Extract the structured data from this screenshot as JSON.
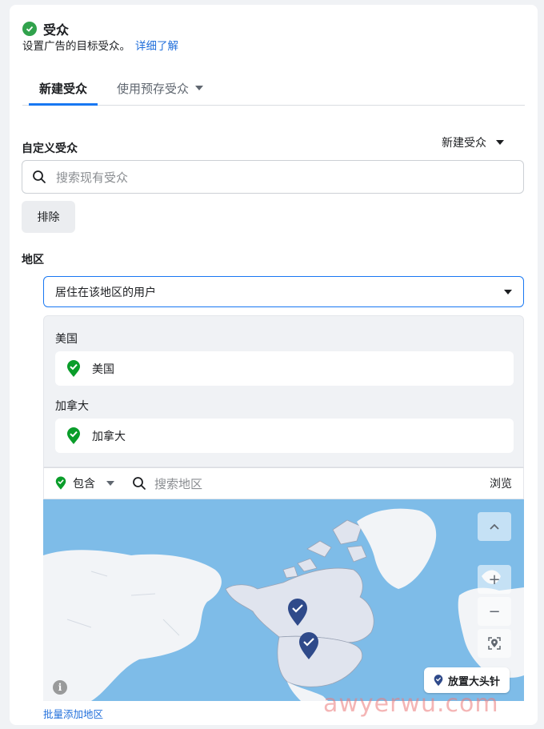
{
  "section": {
    "title": "受众",
    "subtitle": "设置广告的目标受众。",
    "learn_more": "详细了解"
  },
  "tabs": {
    "active": "新建受众",
    "other": "使用预存受众"
  },
  "custom_audience": {
    "label": "自定义受众",
    "new_audience": "新建受众",
    "search_placeholder": "搜索现有受众",
    "exclude_button": "排除"
  },
  "region": {
    "label": "地区",
    "selected_option": "居住在该地区的用户",
    "groups": [
      {
        "heading": "美国",
        "item": "美国"
      },
      {
        "heading": "加拿大",
        "item": "加拿大"
      }
    ],
    "include_label": "包含",
    "search_placeholder": "搜索地区",
    "browse": "浏览"
  },
  "map": {
    "zoom_in": "+",
    "zoom_out": "−",
    "drop_pin": "放置大头针",
    "info": "i"
  },
  "bulk_add": "批量添加地区",
  "watermark": "awyerwu.com",
  "colors": {
    "accent": "#1877f2",
    "success": "#31a24c",
    "link": "#216fdb",
    "ocean": "#7ebce8",
    "pin": "#2f4a8a",
    "include_pin": "#0a9d2a"
  }
}
